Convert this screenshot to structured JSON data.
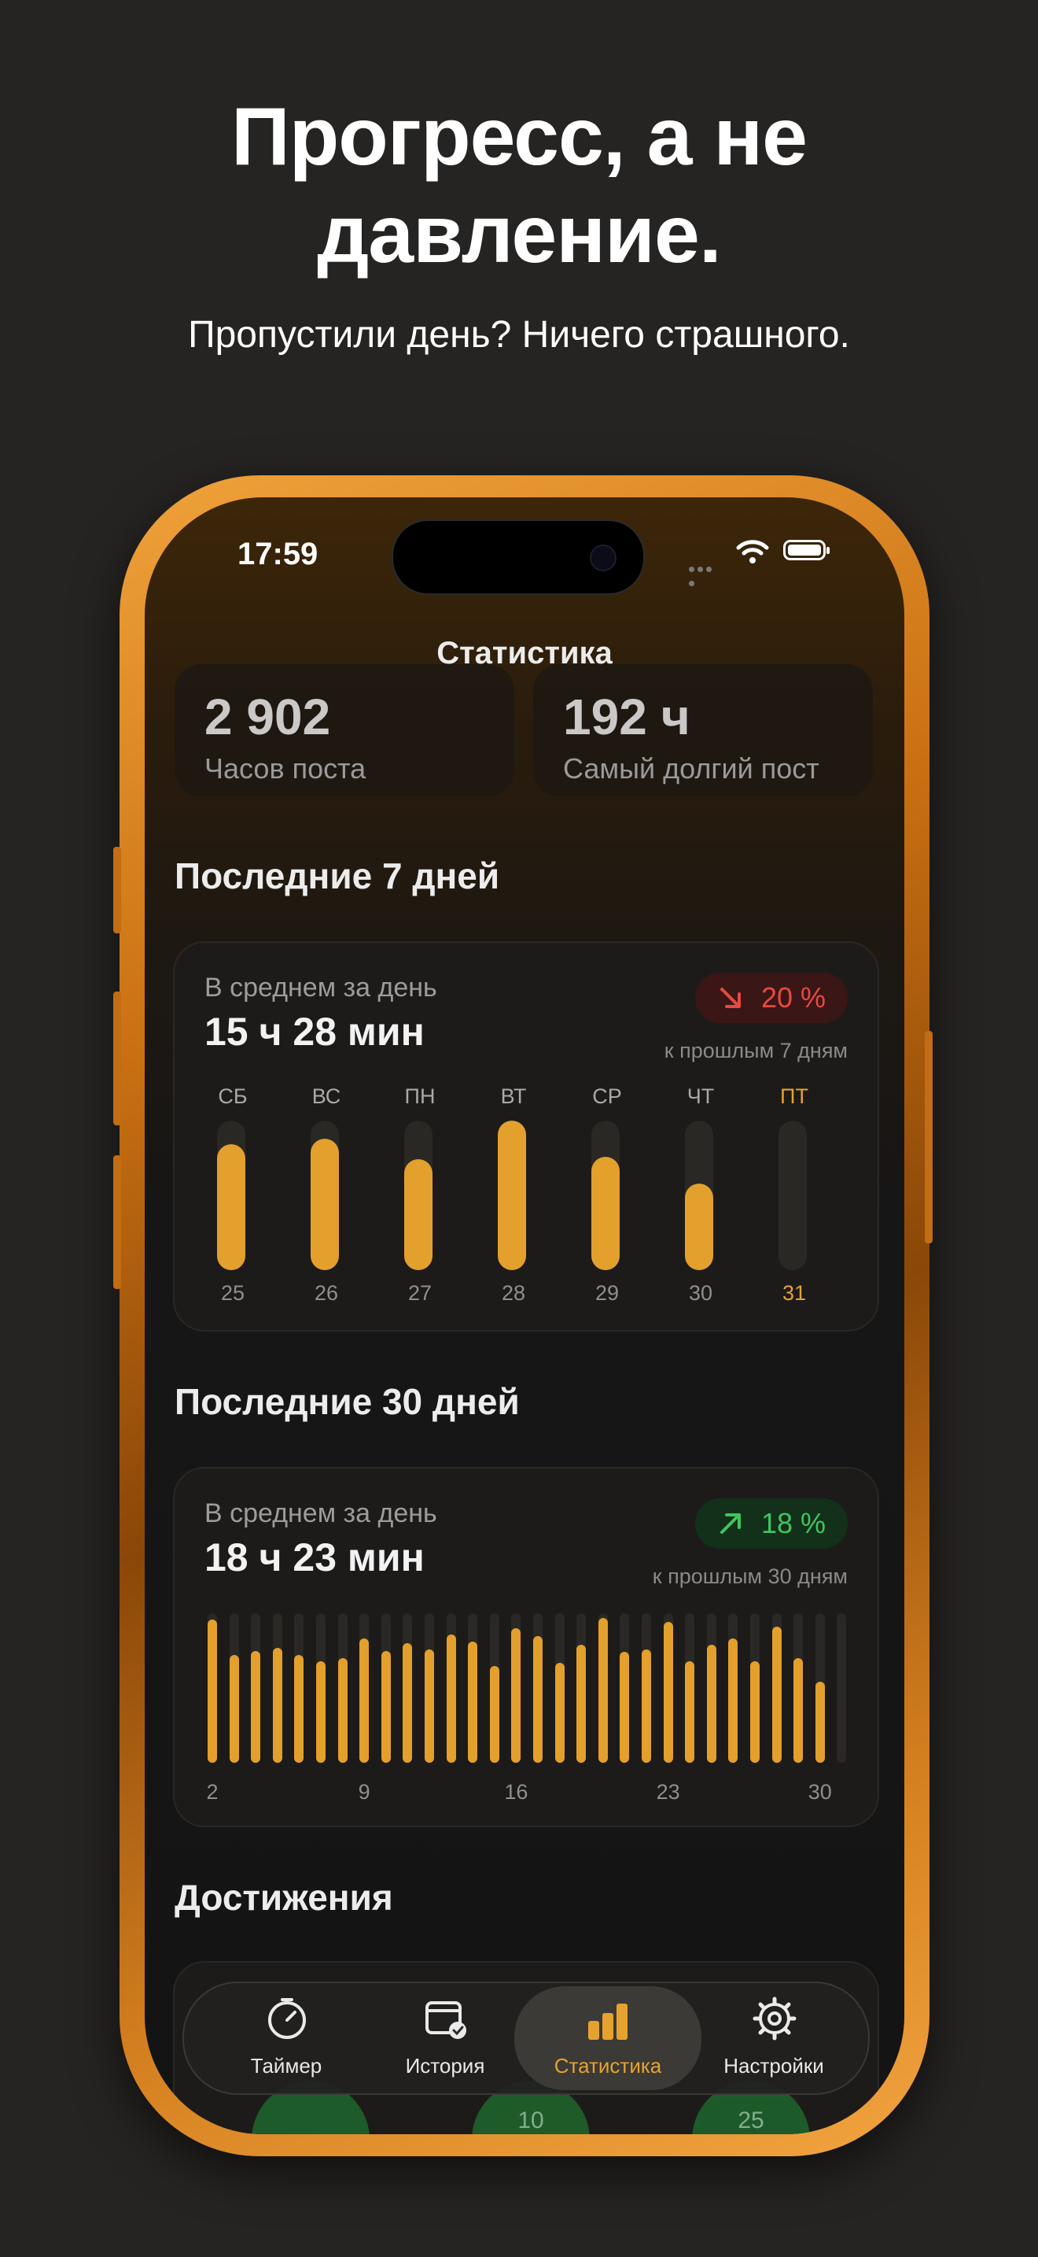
{
  "headline": {
    "line1": "Прогресс, а не",
    "line2": "давление."
  },
  "subheadline": "Пропустили день? Ничего страшного.",
  "status_bar": {
    "time": "17:59"
  },
  "nav": {
    "title": "Статистика"
  },
  "stats": [
    {
      "value": "2 902",
      "label": "Часов поста"
    },
    {
      "value": "192 ч",
      "label": "Самый долгий пост"
    }
  ],
  "week": {
    "section_title": "Последние 7 дней",
    "avg_label": "В среднем за день",
    "avg_value": "15 ч 28 мин",
    "trend": {
      "direction": "down",
      "text": "20 %",
      "color": "#e74a3f"
    },
    "compare_label": "к прошлым 7 дням",
    "days": [
      {
        "day": "СБ",
        "date": "25",
        "fill": 0.84,
        "today": false
      },
      {
        "day": "ВС",
        "date": "26",
        "fill": 0.88,
        "today": false
      },
      {
        "day": "ПН",
        "date": "27",
        "fill": 0.74,
        "today": false
      },
      {
        "day": "ВТ",
        "date": "28",
        "fill": 1.0,
        "today": false
      },
      {
        "day": "СР",
        "date": "29",
        "fill": 0.76,
        "today": false
      },
      {
        "day": "ЧТ",
        "date": "30",
        "fill": 0.58,
        "today": false
      },
      {
        "day": "ПТ",
        "date": "31",
        "fill": 0.0,
        "today": true
      }
    ]
  },
  "month": {
    "section_title": "Последние 30 дней",
    "avg_label": "В среднем за день",
    "avg_value": "18 ч 23 мин",
    "trend": {
      "direction": "up",
      "text": "18 %",
      "color": "#3fc560"
    },
    "compare_label": "к прошлым 30 дням",
    "axis_labels": [
      "2",
      "9",
      "16",
      "23",
      "30"
    ],
    "bars": [
      0.96,
      0.72,
      0.75,
      0.77,
      0.72,
      0.68,
      0.7,
      0.83,
      0.75,
      0.8,
      0.76,
      0.86,
      0.81,
      0.65,
      0.9,
      0.85,
      0.67,
      0.79,
      0.97,
      0.74,
      0.76,
      0.94,
      0.68,
      0.79,
      0.83,
      0.68,
      0.91,
      0.7,
      0.54,
      0.0
    ]
  },
  "achievements": {
    "section_title": "Достижения",
    "badges": [
      "10",
      "25"
    ]
  },
  "tabs": [
    {
      "label": "Таймер",
      "icon": "timer-icon",
      "active": false
    },
    {
      "label": "История",
      "icon": "calendar-check-icon",
      "active": false
    },
    {
      "label": "Статистика",
      "icon": "bar-chart-icon",
      "active": true
    },
    {
      "label": "Настройки",
      "icon": "gear-icon",
      "active": false
    }
  ],
  "colors": {
    "accent": "#e4a02c",
    "background": "#252422",
    "frame": "#c86f12"
  }
}
